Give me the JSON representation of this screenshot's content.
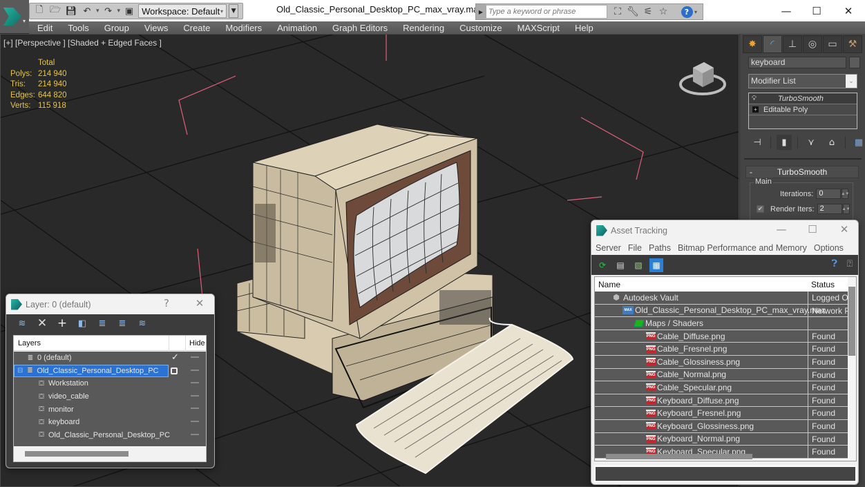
{
  "app": {
    "title": "Old_Classic_Personal_Desktop_PC_max_vray.max",
    "workspace": "Workspace: Default",
    "search_placeholder": "Type a keyword or phrase",
    "quick_access": [
      "new-file-icon",
      "open-folder-icon",
      "save-icon",
      "undo-icon",
      "redo-icon",
      "project-folder-icon"
    ],
    "info_center_icons": [
      "binoculars-icon",
      "wrench-icon",
      "satellite-icon",
      "star-icon"
    ],
    "window_controls": {
      "minimize": "—",
      "maximize": "☐",
      "close": "✕"
    }
  },
  "menubar": [
    "Edit",
    "Tools",
    "Group",
    "Views",
    "Create",
    "Modifiers",
    "Animation",
    "Graph Editors",
    "Rendering",
    "Customize",
    "MAXScript",
    "Help"
  ],
  "viewport": {
    "label": "[+] [Perspective ] [Shaded + Edged Faces ]",
    "stats": {
      "header": "Total",
      "rows": [
        {
          "label": "Polys:",
          "value": "214 940"
        },
        {
          "label": "Tris:",
          "value": "214 940"
        },
        {
          "label": "Edges:",
          "value": "644 820"
        },
        {
          "label": "Verts:",
          "value": "115 918"
        }
      ]
    },
    "colors": {
      "stats_text": "#e6c54a",
      "background": "#292929",
      "selection_bracket": "#e0607a",
      "model_beige": "#d8cbb0",
      "screen": "#d9dadc"
    }
  },
  "command_panel": {
    "tabs": [
      "create-icon",
      "modify-icon",
      "hierarchy-icon",
      "motion-icon",
      "display-icon",
      "utilities-icon"
    ],
    "active_tab": 1,
    "object_name": "keyboard",
    "modifier_list": "Modifier List",
    "stack": [
      {
        "label": "TurboSmooth",
        "selected": true
      },
      {
        "label": "Editable Poly",
        "selected": false
      }
    ],
    "rollout": {
      "title": "TurboSmooth",
      "collapse": "-",
      "group": "Main",
      "iterations_label": "Iterations:",
      "iterations_value": "0",
      "render_iters_label": "Render Iters:",
      "render_iters_value": "2",
      "render_iters_checked": true
    }
  },
  "layer_dialog": {
    "title": "Layer: 0 (default)",
    "help": "?",
    "close": "✕",
    "tools": [
      "create-layer-icon",
      "delete-layer-icon",
      "add-to-layer-icon",
      "select-objects-icon",
      "select-layer-icon",
      "highlight-layer-icon",
      "layer-settings-icon"
    ],
    "columns": [
      "Layers",
      "Hide"
    ],
    "rows": [
      {
        "name": "0 (default)",
        "type": "layer",
        "indent": 1,
        "active": true,
        "selected": false
      },
      {
        "name": "Old_Classic_Personal_Desktop_PC",
        "type": "layer",
        "indent": 0,
        "active": false,
        "selected": true
      },
      {
        "name": "Workstation",
        "type": "object",
        "indent": 2
      },
      {
        "name": "video_cable",
        "type": "object",
        "indent": 2
      },
      {
        "name": "monitor",
        "type": "object",
        "indent": 2
      },
      {
        "name": "keyboard",
        "type": "object",
        "indent": 2
      },
      {
        "name": "Old_Classic_Personal_Desktop_PC",
        "type": "object",
        "indent": 2
      }
    ]
  },
  "asset_dialog": {
    "title": "Asset Tracking",
    "menu": [
      "Server",
      "File",
      "Paths",
      "Bitmap Performance and Memory",
      "Options"
    ],
    "columns": [
      "Name",
      "Status"
    ],
    "rows": [
      {
        "name": "Autodesk Vault",
        "status": "Logged Out",
        "icon": "vault",
        "indent": 1
      },
      {
        "name": "Old_Classic_Personal_Desktop_PC_max_vray.max",
        "status": "Network Path",
        "icon": "max",
        "indent": 2
      },
      {
        "name": "Maps / Shaders",
        "status": "",
        "icon": "maps",
        "indent": 3
      },
      {
        "name": "Cable_Diffuse.png",
        "status": "Found",
        "icon": "png",
        "indent": 4
      },
      {
        "name": "Cable_Fresnel.png",
        "status": "Found",
        "icon": "png",
        "indent": 4
      },
      {
        "name": "Cable_Glossiness.png",
        "status": "Found",
        "icon": "png",
        "indent": 4
      },
      {
        "name": "Cable_Normal.png",
        "status": "Found",
        "icon": "png",
        "indent": 4
      },
      {
        "name": "Cable_Specular.png",
        "status": "Found",
        "icon": "png",
        "indent": 4
      },
      {
        "name": "Keyboard_Diffuse.png",
        "status": "Found",
        "icon": "png",
        "indent": 4
      },
      {
        "name": "Keyboard_Fresnel.png",
        "status": "Found",
        "icon": "png",
        "indent": 4
      },
      {
        "name": "Keyboard_Glossiness.png",
        "status": "Found",
        "icon": "png",
        "indent": 4
      },
      {
        "name": "Keyboard_Normal.png",
        "status": "Found",
        "icon": "png",
        "indent": 4
      },
      {
        "name": "Keyboard_Specular.png",
        "status": "Found",
        "icon": "png",
        "indent": 4
      }
    ]
  }
}
